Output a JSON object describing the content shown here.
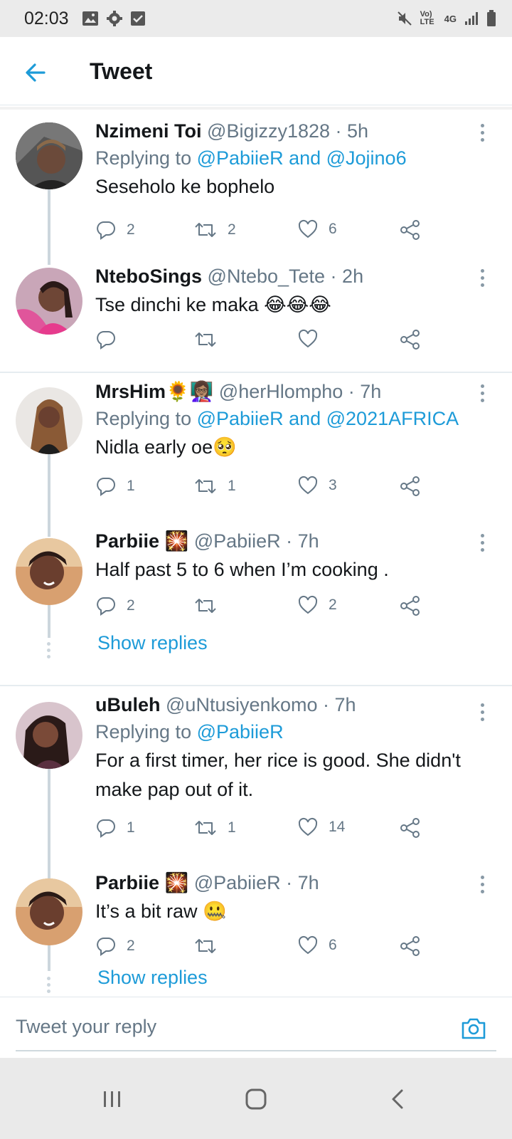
{
  "status_bar": {
    "time": "02:03",
    "left_icons": [
      "image-icon",
      "gear-icon",
      "checkbox-icon"
    ],
    "right_icons": [
      "mute-icon",
      "volte-icon",
      "4g-icon",
      "signal-icon",
      "battery-icon"
    ],
    "volte_label": "Vo) LTE",
    "network_label": "4G"
  },
  "header": {
    "title": "Tweet"
  },
  "tweets": [
    {
      "name": "Nzimeni Toi",
      "handle": "@Bigizzy1828",
      "time": "5h",
      "replying_prefix": "Replying to",
      "replying_mentions": "@PabiieR and @Jojino6",
      "text": "Seseholo ke bophelo",
      "replies": "2",
      "retweets": "2",
      "likes": "6"
    },
    {
      "name": "NteboSings",
      "handle": "@Ntebo_Tete",
      "time": "2h",
      "text": "Tse dinchi ke maka 😂😂😂",
      "replies": "",
      "retweets": "",
      "likes": ""
    },
    {
      "name": "MrsHim🌻👩🏽‍🏫",
      "handle": "@herHlompho",
      "time": "7h",
      "replying_prefix": "Replying to",
      "replying_mentions": "@PabiieR and @2021AFRICA",
      "text": "Nidla early oe🥺",
      "replies": "1",
      "retweets": "1",
      "likes": "3"
    },
    {
      "name": "Parbiie 🎇",
      "handle": "@PabiieR",
      "time": "7h",
      "text": "Half past 5 to 6 when I’m cooking .",
      "replies": "2",
      "retweets": "",
      "likes": "2",
      "show_replies": "Show replies"
    },
    {
      "name": "uBuleh",
      "handle": "@uNtusiyenkomo",
      "time": "7h",
      "replying_prefix": "Replying to",
      "replying_mentions": "@PabiieR",
      "text": "For a first timer, her rice is good. She didn't make pap out of it.",
      "replies": "1",
      "retweets": "1",
      "likes": "14"
    },
    {
      "name": "Parbiie 🎇",
      "handle": "@PabiieR",
      "time": "7h",
      "text": "It’s a bit raw 🤐",
      "replies": "2",
      "retweets": "",
      "likes": "6",
      "show_replies": "Show replies"
    }
  ],
  "reply_bar": {
    "placeholder": "Tweet your reply",
    "camera_icon": "camera-icon"
  },
  "nav_bar": {
    "icons": [
      "recents-icon",
      "home-icon",
      "back-icon"
    ]
  },
  "colors": {
    "accent": "#1d9bd8",
    "secondary_text": "#657786",
    "primary_text": "#14171a",
    "thread_line": "#ccd6dd"
  }
}
